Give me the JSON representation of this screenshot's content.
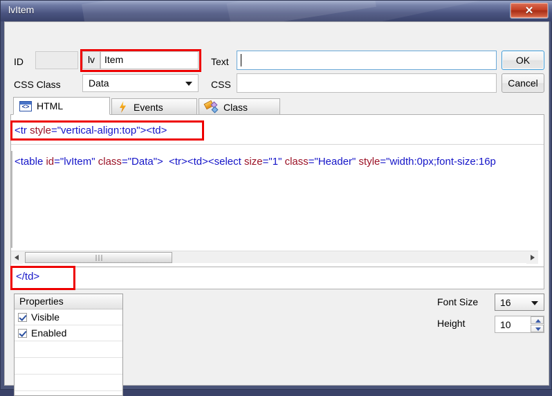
{
  "window": {
    "title": "lvItem",
    "close_label": "✕"
  },
  "form": {
    "id_label": "ID",
    "id_value": "",
    "name_prefix": "lv",
    "name_value": "Item",
    "css_class_label": "CSS Class",
    "css_class_value": "Data",
    "text_label": "Text",
    "text_value": "",
    "css_label": "CSS",
    "css_value": "",
    "ok_label": "OK",
    "cancel_label": "Cancel"
  },
  "tabs": [
    {
      "label": "HTML",
      "icon": "code-icon",
      "active": true
    },
    {
      "label": "Events",
      "icon": "bolt-icon",
      "active": false
    },
    {
      "label": "Class",
      "icon": "shapes-icon",
      "active": false
    }
  ],
  "code": {
    "top_line": "<tr style=\"vertical-align:top\"><td>",
    "top_tokens": [
      {
        "t": "<tr ",
        "c": "tag"
      },
      {
        "t": "style",
        "c": "attr"
      },
      {
        "t": "=\"vertical-align:top\"><td>",
        "c": "tag"
      }
    ],
    "body_line": "<table id=\"lvItem\" class=\"Data\">  <tr><td><select size=\"1\" class=\"Header\" style=\"width:0px;font-size:16p",
    "body_tokens": [
      {
        "t": "<table ",
        "c": "tag"
      },
      {
        "t": "id",
        "c": "attr"
      },
      {
        "t": "=\"lvItem\" ",
        "c": "tag"
      },
      {
        "t": "class",
        "c": "attr"
      },
      {
        "t": "=\"Data\">  <tr><td><select ",
        "c": "tag"
      },
      {
        "t": "size",
        "c": "attr"
      },
      {
        "t": "=\"1\" ",
        "c": "tag"
      },
      {
        "t": "class",
        "c": "attr"
      },
      {
        "t": "=\"Header\" ",
        "c": "tag"
      },
      {
        "t": "style",
        "c": "attr"
      },
      {
        "t": "=\"width:0px;font-size:16p",
        "c": "tag"
      }
    ],
    "bottom_line": "</td>"
  },
  "properties": {
    "header": "Properties",
    "rows": [
      {
        "label": "Visible",
        "checked": true
      },
      {
        "label": "Enabled",
        "checked": true
      }
    ]
  },
  "controls": {
    "font_size_label": "Font Size",
    "font_size_value": "16",
    "height_label": "Height",
    "height_value": "10"
  },
  "colors": {
    "title_bar": "#4a5480",
    "close_button": "#c23e23",
    "highlight_box": "#ee0000",
    "tag_blue": "#1414c8",
    "attr_red": "#9b1226",
    "focus_blue": "#3c9ad6"
  }
}
